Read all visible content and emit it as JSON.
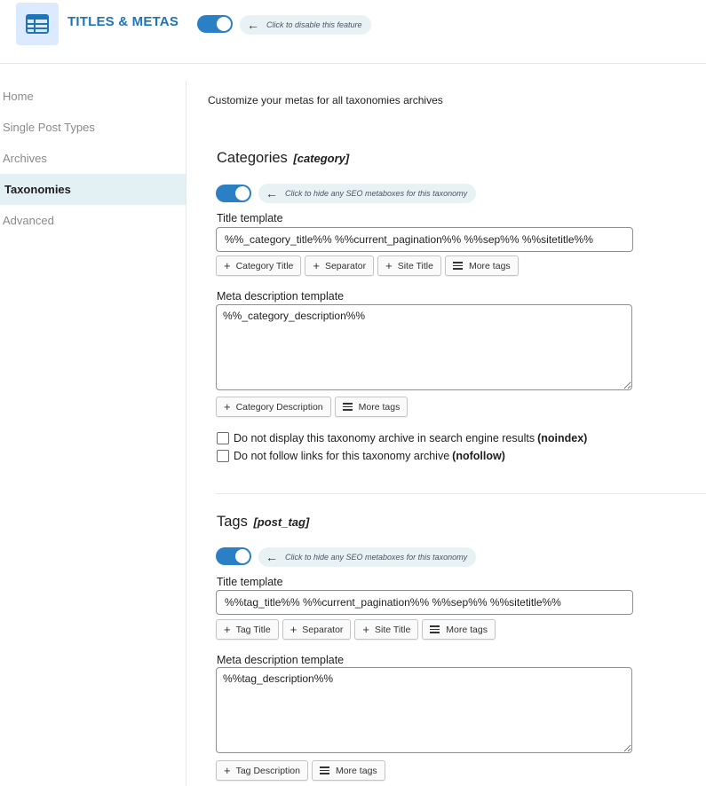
{
  "header": {
    "title": "TITLES & METAS",
    "toggle_on": true,
    "hint": "Click to disable this feature",
    "logo_icon": "table-icon"
  },
  "sidebar": {
    "items": [
      {
        "label": "Home"
      },
      {
        "label": "Single Post Types"
      },
      {
        "label": "Archives"
      },
      {
        "label": "Taxonomies",
        "active": true
      },
      {
        "label": "Advanced"
      }
    ]
  },
  "main": {
    "intro": "Customize your metas for all taxonomies archives",
    "sections": [
      {
        "name": "Categories",
        "slug": "[category]",
        "toggle_hint": "Click to hide any SEO metaboxes for this taxonomy",
        "title_label": "Title template",
        "title_value": "%%_category_title%% %%current_pagination%% %%sep%% %%sitetitle%%",
        "title_buttons": [
          "Category Title",
          "Separator",
          "Site Title",
          "More tags"
        ],
        "desc_label": "Meta description template",
        "desc_value": "%%_category_description%%",
        "desc_buttons": [
          "Category Description",
          "More tags"
        ],
        "noindex_text": "Do not display this taxonomy archive in search engine results ",
        "noindex_strong": "(noindex)",
        "nofollow_text": "Do not follow links for this taxonomy archive ",
        "nofollow_strong": "(nofollow)"
      },
      {
        "name": "Tags",
        "slug": "[post_tag]",
        "toggle_hint": "Click to hide any SEO metaboxes for this taxonomy",
        "title_label": "Title template",
        "title_value": "%%tag_title%% %%current_pagination%% %%sep%% %%sitetitle%%",
        "title_buttons": [
          "Tag Title",
          "Separator",
          "Site Title",
          "More tags"
        ],
        "desc_label": "Meta description template",
        "desc_value": "%%tag_description%%",
        "desc_buttons": [
          "Tag Description",
          "More tags"
        ]
      }
    ]
  },
  "colors": {
    "accent": "#1f73b7",
    "toggle": "#2a7fc5",
    "logo_bg": "#dbeafe",
    "active_nav_bg": "#e3f0f4"
  }
}
